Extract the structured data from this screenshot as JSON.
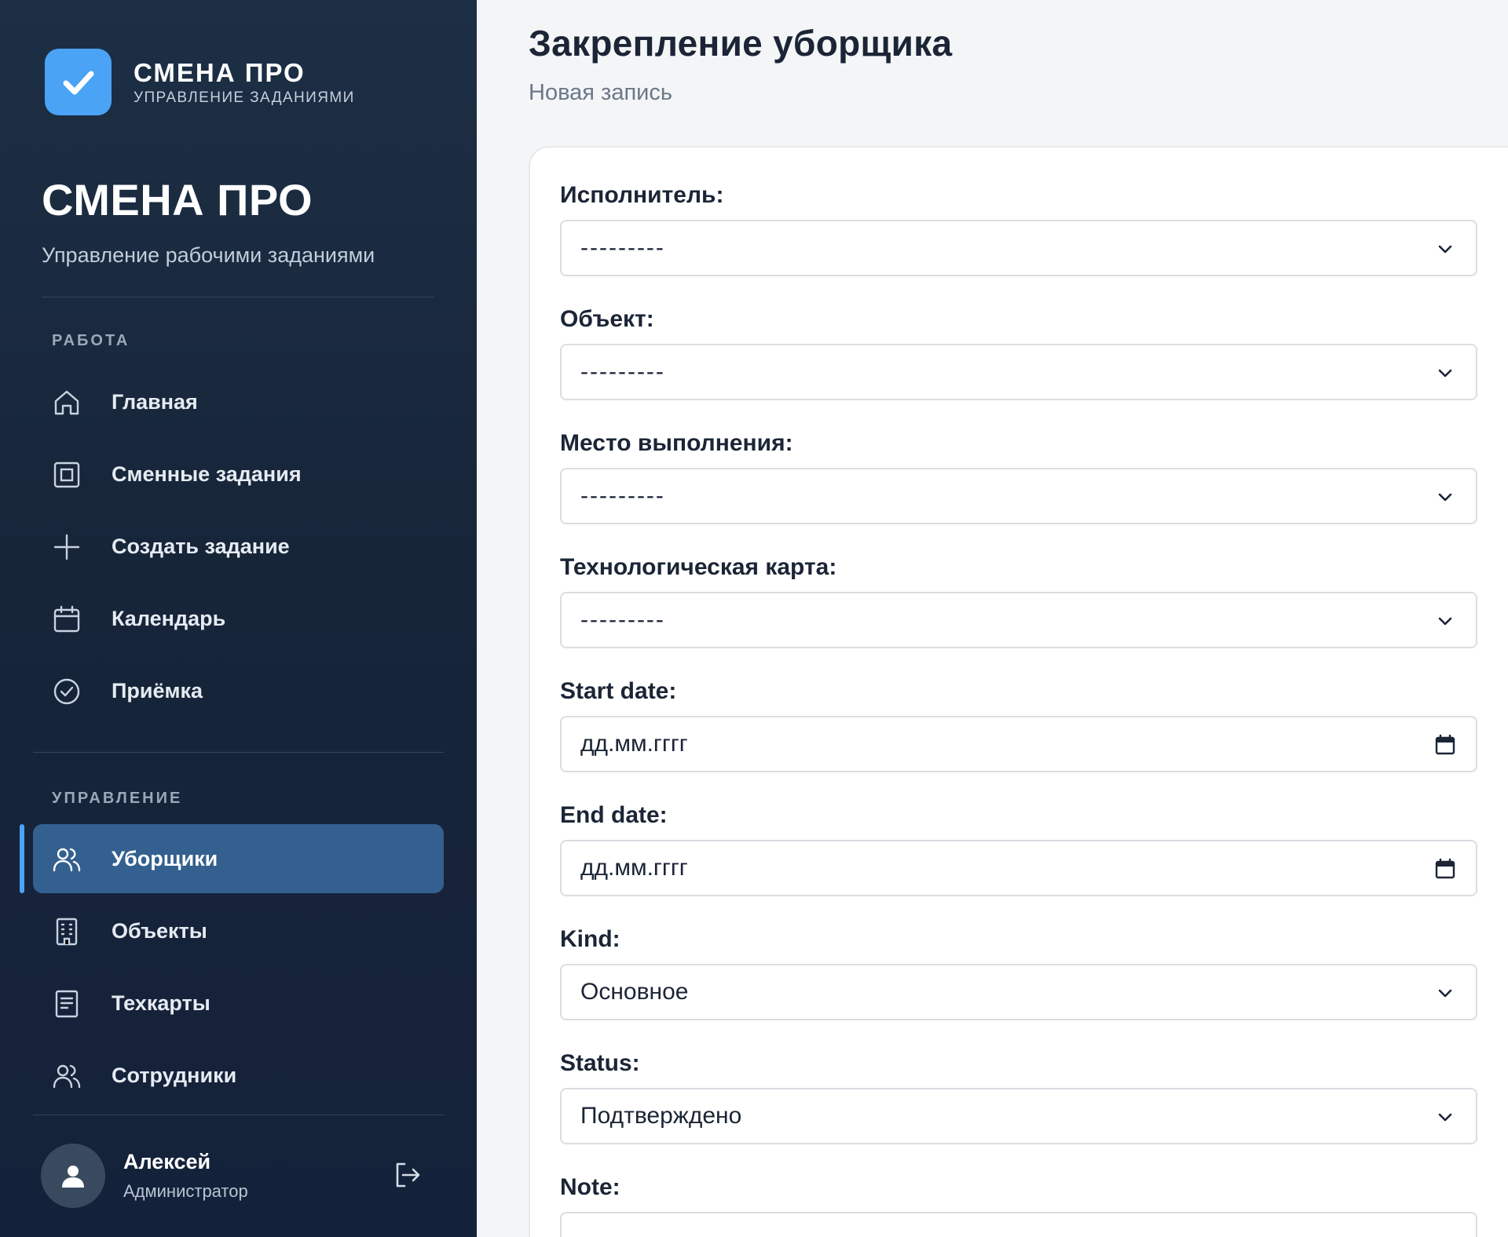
{
  "brand": {
    "name": "СМЕНА ПРО",
    "subtitle": "УПРАВЛЕНИЕ ЗАДАНИЯМИ"
  },
  "hero": {
    "title": "СМЕНА ПРО",
    "subtitle": "Управление рабочими заданиями"
  },
  "sidebar": {
    "work_section": "РАБОТА",
    "work_items": [
      {
        "label": "Главная",
        "icon": "home-icon"
      },
      {
        "label": "Сменные задания",
        "icon": "tasks-icon"
      },
      {
        "label": "Создать задание",
        "icon": "plus-icon"
      },
      {
        "label": "Календарь",
        "icon": "calendar-icon"
      },
      {
        "label": "Приёмка",
        "icon": "check-circle-icon"
      }
    ],
    "manage_section": "УПРАВЛЕНИЕ",
    "manage_items": [
      {
        "label": "Уборщики",
        "icon": "users-icon",
        "active": true
      },
      {
        "label": "Объекты",
        "icon": "building-icon"
      },
      {
        "label": "Техкарты",
        "icon": "document-icon"
      },
      {
        "label": "Сотрудники",
        "icon": "users-icon"
      }
    ]
  },
  "user": {
    "name": "Алексей",
    "role": "Администратор"
  },
  "page": {
    "title": "Закрепление уборщика",
    "subtitle": "Новая запись"
  },
  "form": {
    "fields": [
      {
        "label": "Исполнитель:",
        "value": "---------",
        "type": "select"
      },
      {
        "label": "Объект:",
        "value": "---------",
        "type": "select"
      },
      {
        "label": "Место выполнения:",
        "value": "---------",
        "type": "select"
      },
      {
        "label": "Технологическая карта:",
        "value": "---------",
        "type": "select"
      },
      {
        "label": "Start date:",
        "value": "дд.мм.гггг",
        "type": "date"
      },
      {
        "label": "End date:",
        "value": "дд.мм.гггг",
        "type": "date"
      },
      {
        "label": "Kind:",
        "value": "Основное",
        "type": "select"
      },
      {
        "label": "Status:",
        "value": "Подтверждено",
        "type": "select"
      },
      {
        "label": "Note:",
        "value": "",
        "type": "textarea"
      }
    ]
  },
  "colors": {
    "sidebar_bg": "#172539",
    "accent": "#4aa3f5",
    "active_item": "#33608f",
    "page_bg": "#f4f5f7"
  }
}
